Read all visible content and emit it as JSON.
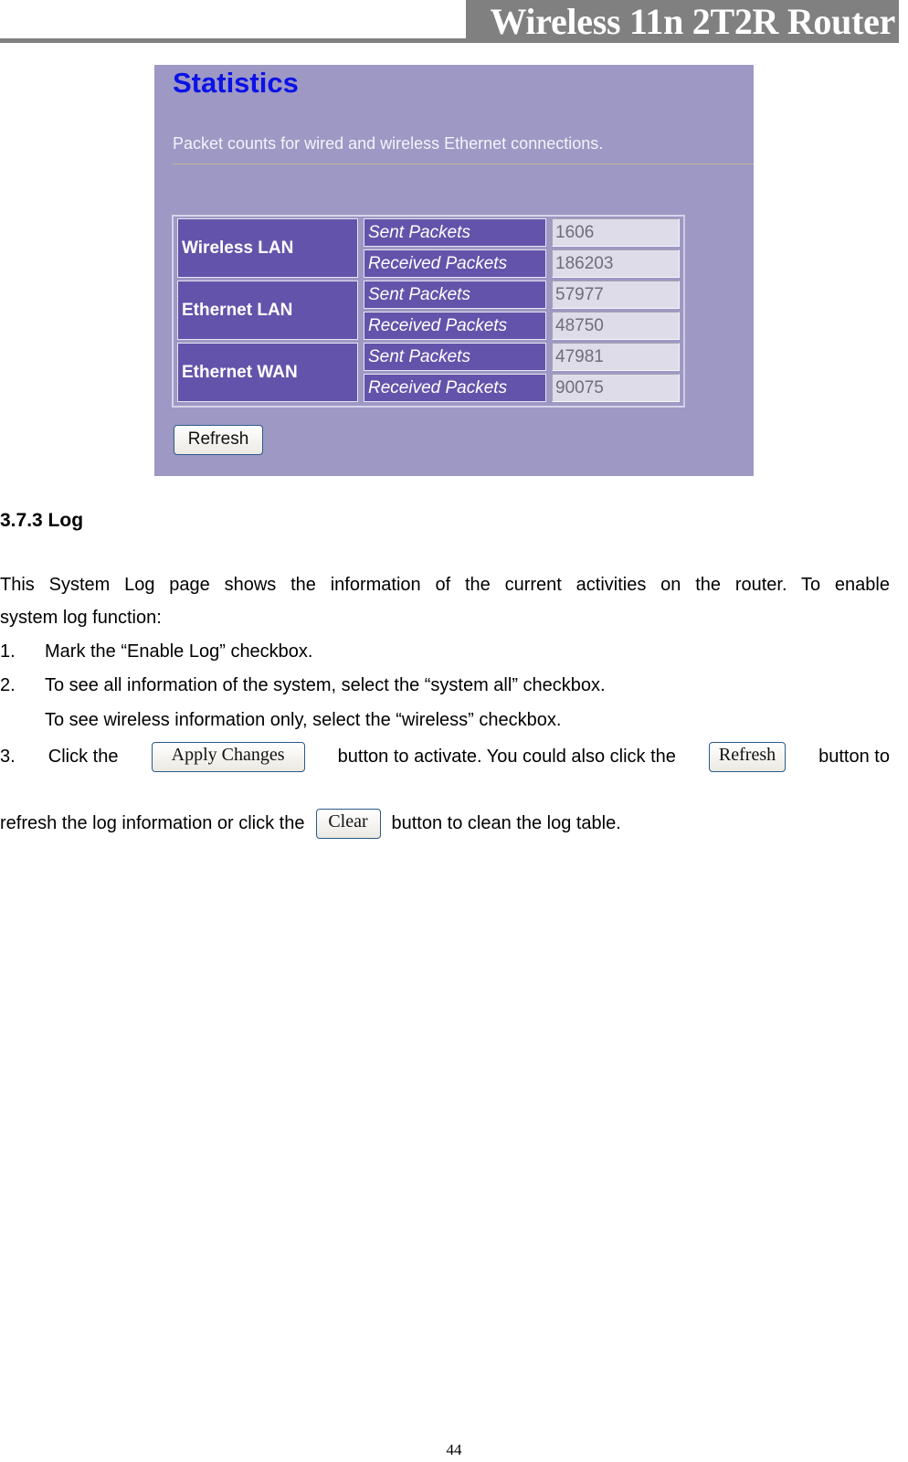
{
  "header": {
    "title": "Wireless 11n 2T2R Router"
  },
  "statistics_panel": {
    "title": "Statistics",
    "description": "Packet counts for wired and wireless Ethernet connections.",
    "groups": [
      {
        "label": "Wireless LAN",
        "rows": [
          {
            "label": "Sent Packets",
            "value": "1606"
          },
          {
            "label": "Received Packets",
            "value": "186203"
          }
        ]
      },
      {
        "label": "Ethernet LAN",
        "rows": [
          {
            "label": "Sent Packets",
            "value": "57977"
          },
          {
            "label": "Received Packets",
            "value": "48750"
          }
        ]
      },
      {
        "label": "Ethernet WAN",
        "rows": [
          {
            "label": "Sent Packets",
            "value": "47981"
          },
          {
            "label": "Received Packets",
            "value": "90075"
          }
        ]
      }
    ],
    "refresh_label": "Refresh"
  },
  "section": {
    "heading": "3.7.3 Log",
    "intro_line1": "This System Log page shows the information of the current activities on the router. To enable",
    "intro_line2": "system log function:",
    "steps": [
      {
        "num": "1.",
        "text": "Mark the “Enable Log” checkbox."
      },
      {
        "num": "2.",
        "text": "To see all information of the system, select the “system all” checkbox."
      }
    ],
    "step2_extra": "To see wireless information only, select the “wireless” checkbox.",
    "step3": {
      "num": "3.",
      "part1": "Click the",
      "apply_button": "Apply Changes",
      "part2": "button to activate. You could also click the",
      "refresh_button": "Refresh",
      "part3": "button to",
      "part4": "refresh the log information or click the",
      "clear_button": "Clear",
      "part5": "button to clean the log table."
    }
  },
  "footer": {
    "page_number": "44"
  }
}
